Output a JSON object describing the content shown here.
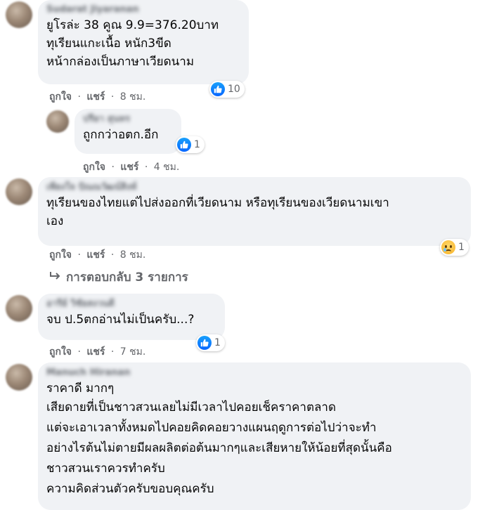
{
  "comments": [
    {
      "name": "Sudarat Jiyaranan",
      "lines": [
        "ยูโรล่ะ 38 คูณ 9.9=376.20บาท",
        "ทุเรียนแกะเนื้อ หนัก3ขีด",
        "หน้ากล่องเป็นภาษาเวียดนาม"
      ],
      "like": "ถูกใจ",
      "share": "แชร์",
      "time": "8 ชม.",
      "reaction_count": "10"
    },
    {
      "name": "ปรียา สุนทร",
      "lines": [
        "ถูกกว่าอตก.อีก"
      ],
      "like": "ถูกใจ",
      "share": "แชร์",
      "time": "4 ชม.",
      "reaction_count": "1"
    },
    {
      "name": "เพียงใจ ปัณณวัฒน์สิงห์",
      "lines": [
        "ทุเรียนของไทยแต่ไปส่งออกที่เวียดนาม หรือทุเรียนของเวียดนามเขา",
        "เอง"
      ],
      "like": "ถูกใจ",
      "share": "แชร์",
      "time": "8 ชม.",
      "reaction_count": "1",
      "replies": "การตอบกลับ 3 รายการ"
    },
    {
      "name": "อารีย์ วิชัยสงวนดี",
      "lines": [
        "จบ ป.5ตกอ่านไม่เป็นครับ...?"
      ],
      "like": "ถูกใจ",
      "share": "แชร์",
      "time": "7 ชม.",
      "reaction_count": "1"
    },
    {
      "name": "Manuch Hiranan",
      "lines": [
        "ราคาดี มากๆ",
        "เสียดายที่เป็นชาวสวนเลยไม่มีเวลาไปคอยเช็คราคาตลาด",
        "แต่จะเอาเวลาทั้งหมดไปคอยคิดคอยวางแผนฤดูการต่อไปว่าจะทำ",
        "อย่างไรต้นไม่ตายมีผลผลิตต่อต้นมากๆและเสียหายให้น้อยที่สุดนั้นคือ",
        "ชาวสวนเราควรทำครับ",
        "ความคิดส่วนตัวครับขอบคุณครับ"
      ]
    }
  ],
  "separator": "·",
  "icons": {
    "like": "like-icon",
    "sad": "sad-face-icon",
    "reply_arrow": "reply-arrow-icon"
  },
  "colors": {
    "bubble": "#f0f2f5",
    "meta": "#65676b",
    "like_blue": "#0866ff"
  }
}
